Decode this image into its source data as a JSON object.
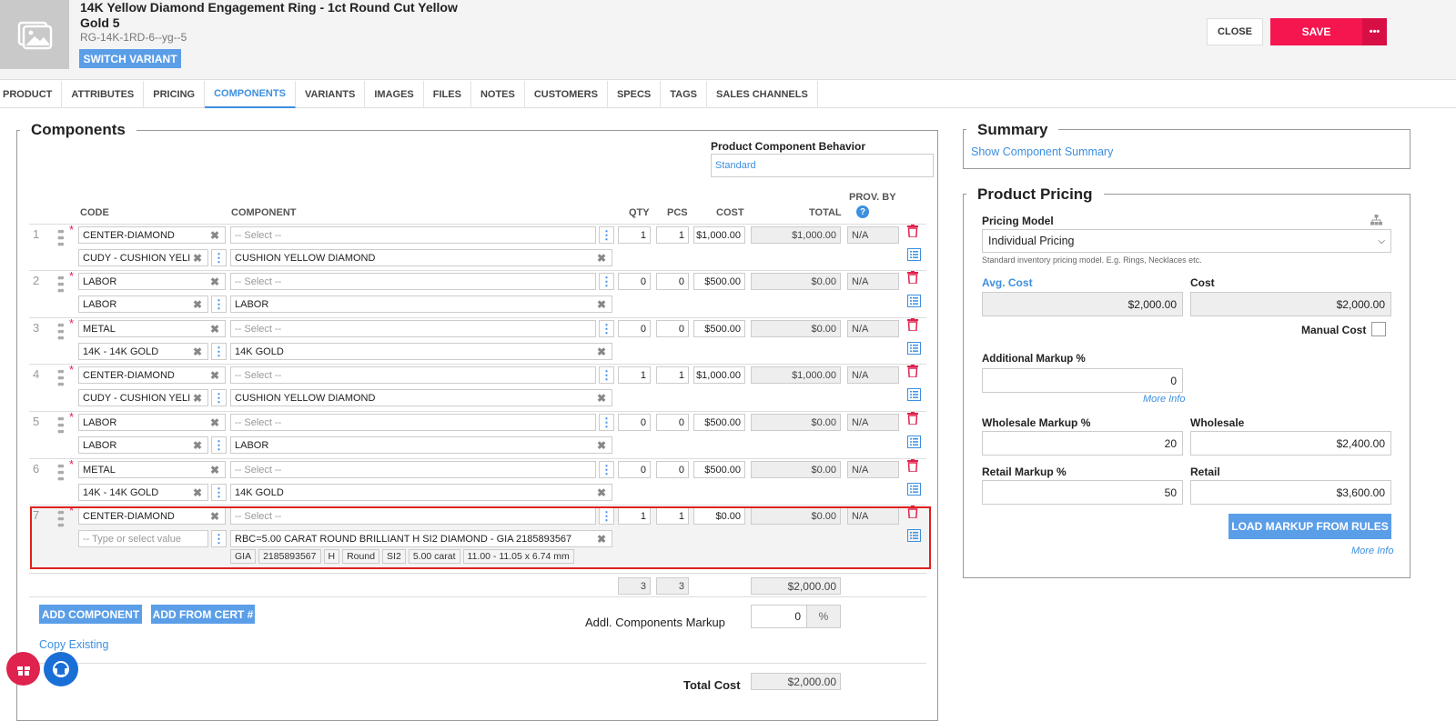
{
  "header": {
    "title": "14K Yellow Diamond Engagement Ring - 1ct Round Cut Yellow Gold 5",
    "sku": "RG-14K-1RD-6--yg--5",
    "switch_variant": "SWITCH VARIANT",
    "close": "CLOSE",
    "save": "SAVE",
    "more": "•••"
  },
  "tabs": [
    "PRODUCT",
    "ATTRIBUTES",
    "PRICING",
    "COMPONENTS",
    "VARIANTS",
    "IMAGES",
    "FILES",
    "NOTES",
    "CUSTOMERS",
    "SPECS",
    "TAGS",
    "SALES CHANNELS"
  ],
  "components": {
    "legend": "Components",
    "behavior_label": "Product Component Behavior",
    "behavior_value": "Standard",
    "columns": {
      "code": "CODE",
      "component": "COMPONENT",
      "qty": "QTY",
      "pcs": "PCS",
      "cost": "COST",
      "total": "TOTAL",
      "prov_by": "PROV. BY"
    },
    "select_placeholder": "-- Select --",
    "rows": [
      {
        "num": "1",
        "code": "CENTER-DIAMOND",
        "sub_code": "CUDY - CUSHION YELI",
        "component": "CUSHION YELLOW DIAMOND",
        "qty": "1",
        "pcs": "1",
        "cost": "$1,000.00",
        "total": "$1,000.00",
        "prov": "N/A"
      },
      {
        "num": "2",
        "code": "LABOR",
        "sub_code": "LABOR",
        "component": "LABOR",
        "qty": "0",
        "pcs": "0",
        "cost": "$500.00",
        "total": "$0.00",
        "prov": "N/A"
      },
      {
        "num": "3",
        "code": "METAL",
        "sub_code": "14K - 14K GOLD",
        "component": "14K GOLD",
        "qty": "0",
        "pcs": "0",
        "cost": "$500.00",
        "total": "$0.00",
        "prov": "N/A"
      },
      {
        "num": "4",
        "code": "CENTER-DIAMOND",
        "sub_code": "CUDY - CUSHION YELI",
        "component": "CUSHION YELLOW DIAMOND",
        "qty": "1",
        "pcs": "1",
        "cost": "$1,000.00",
        "total": "$1,000.00",
        "prov": "N/A"
      },
      {
        "num": "5",
        "code": "LABOR",
        "sub_code": "LABOR",
        "component": "LABOR",
        "qty": "0",
        "pcs": "0",
        "cost": "$500.00",
        "total": "$0.00",
        "prov": "N/A"
      },
      {
        "num": "6",
        "code": "METAL",
        "sub_code": "14K - 14K GOLD",
        "component": "14K GOLD",
        "qty": "0",
        "pcs": "0",
        "cost": "$500.00",
        "total": "$0.00",
        "prov": "N/A"
      },
      {
        "num": "7",
        "code": "CENTER-DIAMOND",
        "sub_code": "",
        "component": "RBC=5.00 CARAT ROUND BRILLIANT H SI2 DIAMOND - GIA 2185893567",
        "qty": "1",
        "pcs": "1",
        "cost": "$0.00",
        "total": "$0.00",
        "prov": "N/A"
      }
    ],
    "sub_code_placeholder": "-- Type or select value",
    "cert_chips": [
      "GIA",
      "2185893567",
      "H",
      "Round",
      "SI2",
      "5.00 carat",
      "11.00 - 11.05 x 6.74 mm"
    ],
    "totals": {
      "qty": "3",
      "pcs": "3",
      "total": "$2,000.00"
    },
    "add_component": "ADD COMPONENT",
    "add_from_cert": "ADD FROM CERT #",
    "addl_markup_label": "Addl. Components Markup",
    "addl_markup_value": "0",
    "percent": "%",
    "copy_existing": "Copy Existing",
    "total_cost_label": "Total Cost",
    "total_cost_value": "$2,000.00"
  },
  "summary": {
    "legend": "Summary",
    "link": "Show Component Summary"
  },
  "pricing": {
    "legend": "Product Pricing",
    "model_label": "Pricing Model",
    "model_value": "Individual Pricing",
    "model_help": "Standard inventory pricing model. E.g. Rings, Necklaces etc.",
    "avg_cost_label": "Avg. Cost",
    "avg_cost_value": "$2,000.00",
    "cost_label": "Cost",
    "cost_value": "$2,000.00",
    "manual_cost_label": "Manual Cost",
    "addl_markup_label": "Additional Markup %",
    "addl_markup_value": "0",
    "more_info": "More Info",
    "wholesale_markup_label": "Wholesale Markup %",
    "wholesale_markup_value": "20",
    "wholesale_label": "Wholesale",
    "wholesale_value": "$2,400.00",
    "retail_markup_label": "Retail Markup %",
    "retail_markup_value": "50",
    "retail_label": "Retail",
    "retail_value": "$3,600.00",
    "load_markup": "LOAD MARKUP FROM RULES"
  },
  "colors": {
    "accent": "#3d8fe0",
    "save": "#f5164f",
    "danger": "#e0224e",
    "highlight": "#e02020"
  }
}
